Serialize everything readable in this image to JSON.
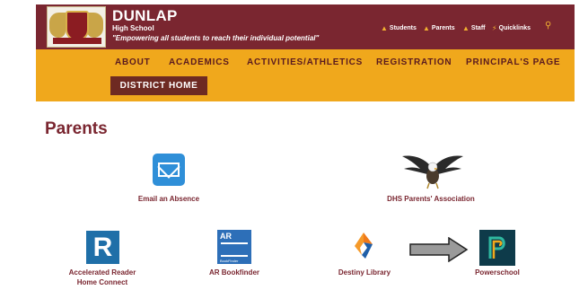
{
  "header": {
    "school_name": "DUNLAP",
    "school_type": "High School",
    "motto": "\"Empowering all students to reach their individual potential\"",
    "logo_icon": "school-crest-icon",
    "utility_links": [
      {
        "label": "Students",
        "icon": "person-icon"
      },
      {
        "label": "Parents",
        "icon": "person-icon"
      },
      {
        "label": "Staff",
        "icon": "person-icon"
      },
      {
        "label": "Quicklinks",
        "icon": "bolt-icon"
      }
    ],
    "search_icon": "search-icon"
  },
  "nav": {
    "items": [
      "ABOUT",
      "ACADEMICS",
      "ACTIVITIES/ATHLETICS",
      "REGISTRATION",
      "PRINCIPAL'S PAGE"
    ],
    "district_home": "DISTRICT HOME"
  },
  "main": {
    "title": "Parents",
    "tiles": [
      {
        "label": "Email an Absence",
        "icon": "email-icon"
      },
      {
        "label": "DHS Parents' Association",
        "icon": "eagle-icon"
      },
      {
        "label_line1": "Accelerated Reader",
        "label_line2": "Home Connect",
        "icon": "accelerated-reader-icon"
      },
      {
        "label": "AR Bookfinder",
        "icon": "ar-bookfinder-icon"
      },
      {
        "label": "Destiny Library",
        "icon": "destiny-library-icon"
      },
      {
        "label": "Powerschool",
        "icon": "powerschool-icon"
      }
    ],
    "ar_letter": "R",
    "bookfinder_logo": "AR",
    "bookfinder_logo_sub": "BookFinder"
  },
  "colors": {
    "maroon": "#7a2630",
    "gold": "#f0a81c",
    "district_button": "#6e2a22"
  }
}
